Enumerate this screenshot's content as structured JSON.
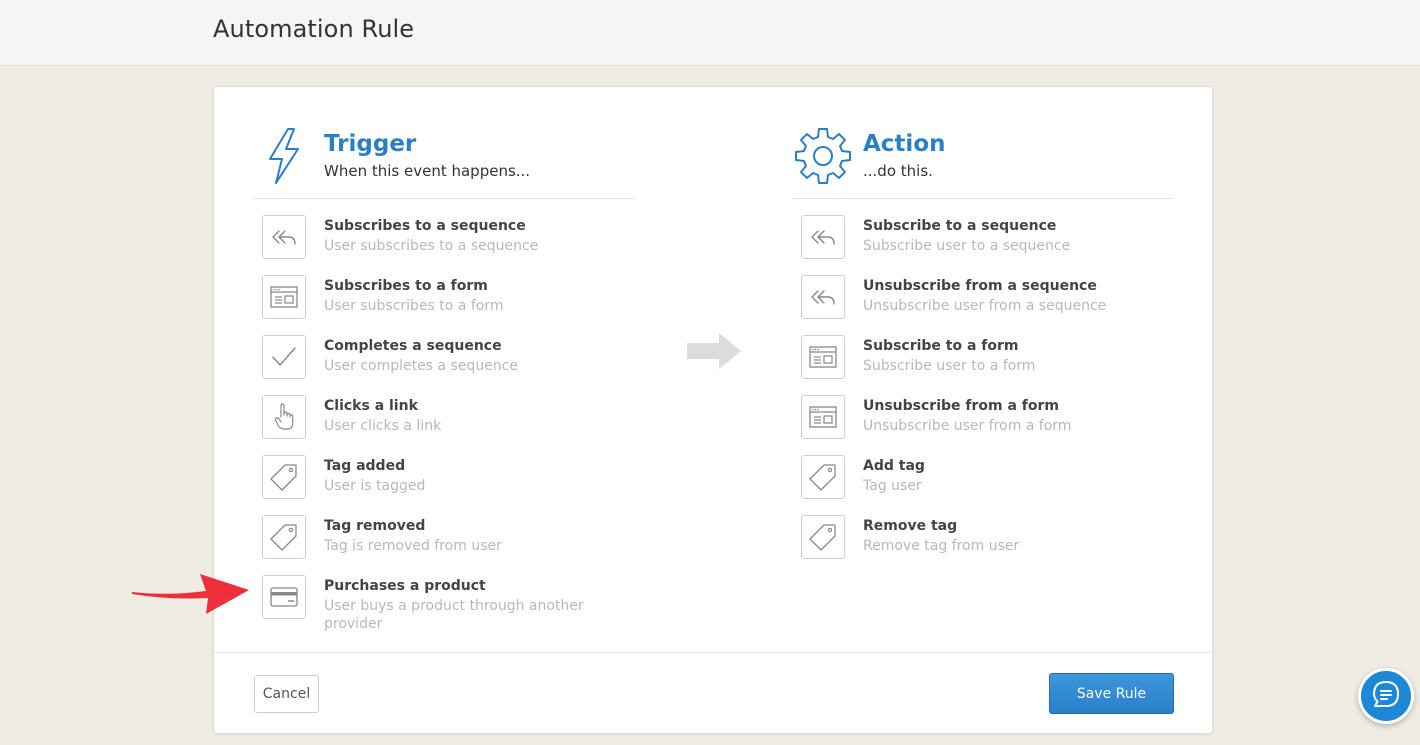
{
  "header": {
    "title": "Automation Rule"
  },
  "trigger": {
    "title": "Trigger",
    "subtitle": "When this event happens...",
    "items": [
      {
        "title": "Subscribes to a sequence",
        "desc": "User subscribes to a sequence",
        "icon": "reply-all-icon"
      },
      {
        "title": "Subscribes to a form",
        "desc": "User subscribes to a form",
        "icon": "form-window-icon"
      },
      {
        "title": "Completes a sequence",
        "desc": "User completes a sequence",
        "icon": "checkmark-icon"
      },
      {
        "title": "Clicks a link",
        "desc": "User clicks a link",
        "icon": "pointer-hand-icon"
      },
      {
        "title": "Tag added",
        "desc": "User is tagged",
        "icon": "tag-icon"
      },
      {
        "title": "Tag removed",
        "desc": "Tag is removed from user",
        "icon": "tag-icon"
      },
      {
        "title": "Purchases a product",
        "desc": "User buys a product through another provider",
        "icon": "credit-card-icon"
      }
    ]
  },
  "action": {
    "title": "Action",
    "subtitle": "...do this.",
    "items": [
      {
        "title": "Subscribe to a sequence",
        "desc": "Subscribe user to a sequence",
        "icon": "reply-all-icon"
      },
      {
        "title": "Unsubscribe from a sequence",
        "desc": "Unsubscribe user from a sequence",
        "icon": "reply-all-icon"
      },
      {
        "title": "Subscribe to a form",
        "desc": "Subscribe user to a form",
        "icon": "form-window-icon"
      },
      {
        "title": "Unsubscribe from a form",
        "desc": "Unsubscribe user from a form",
        "icon": "form-window-icon"
      },
      {
        "title": "Add tag",
        "desc": "Tag user",
        "icon": "tag-icon"
      },
      {
        "title": "Remove tag",
        "desc": "Remove tag from user",
        "icon": "tag-icon"
      }
    ]
  },
  "footer": {
    "cancel_label": "Cancel",
    "save_label": "Save Rule"
  },
  "colors": {
    "accent": "#2b7fc4",
    "button": "#2a7fc9",
    "annotation_arrow": "#e8323c",
    "chat": "#1e88d8"
  }
}
